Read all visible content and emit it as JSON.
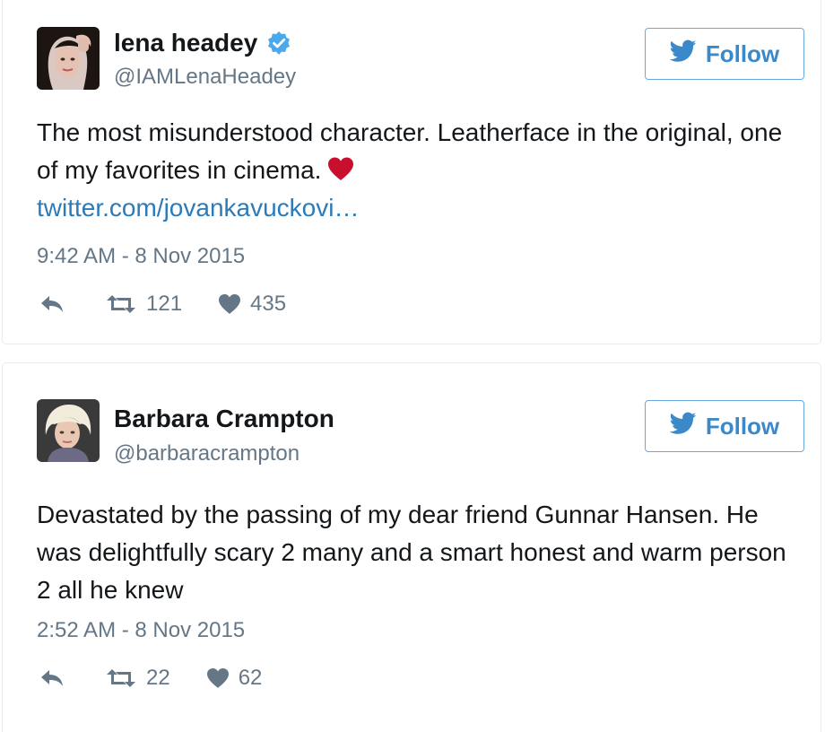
{
  "tweets": [
    {
      "author": {
        "display_name": "lena headey",
        "handle": "@IAMLenaHeadey",
        "verified": true
      },
      "follow_label": "Follow",
      "text": "The most misunderstood character. Leatherface in the original, one of my favorites in cinema.",
      "emoji": "red-heart-emoji",
      "link": "twitter.com/jovankavuckovi…",
      "timestamp": "9:42 AM - 8 Nov 2015",
      "retweets": "121",
      "likes": "435"
    },
    {
      "author": {
        "display_name": "Barbara Crampton",
        "handle": "@barbaracrampton",
        "verified": false
      },
      "follow_label": "Follow",
      "text": "Devastated by the passing of my dear friend Gunnar Hansen. He was delightfully scary 2 many and a smart honest and warm person 2 all he knew",
      "timestamp": "2:52 AM - 8 Nov 2015",
      "retweets": "22",
      "likes": "62"
    }
  ],
  "icons": {
    "verified": "verified-badge-icon",
    "bird": "twitter-bird-icon",
    "reply": "reply-icon",
    "retweet": "retweet-icon",
    "like": "heart-icon"
  },
  "colors": {
    "accent": "#3b89c8",
    "link": "#2b7bb9",
    "muted": "#657786",
    "heart_emoji": "#c8102e"
  }
}
